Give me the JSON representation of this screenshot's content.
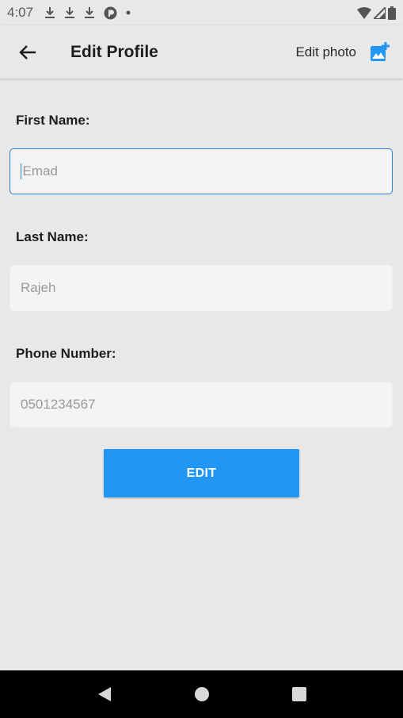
{
  "status_bar": {
    "time": "4:07",
    "icons": [
      "download-icon",
      "download-icon",
      "download-icon",
      "app-notification-icon",
      "dot-icon"
    ],
    "right_icons": [
      "wifi-icon",
      "signal-icon",
      "battery-icon"
    ]
  },
  "app_bar": {
    "back_icon": "arrow-left-icon",
    "title": "Edit Profile",
    "edit_photo_label": "Edit photo",
    "edit_photo_icon": "add-photo-icon"
  },
  "form": {
    "first_name": {
      "label": "First Name:",
      "placeholder": "Emad",
      "focused": true
    },
    "last_name": {
      "label": "Last Name:",
      "placeholder": "Rajeh"
    },
    "phone": {
      "label": "Phone Number:",
      "placeholder": "0501234567"
    },
    "submit_label": "EDIT"
  },
  "colors": {
    "background": "#e8e8e8",
    "field_bg": "#f4f4f4",
    "accent": "#2196f3",
    "focus_border": "#2f7fd2",
    "navbar": "#000000"
  },
  "nav_bar": {
    "buttons": [
      "back-triangle-icon",
      "home-circle-icon",
      "recents-square-icon"
    ]
  }
}
